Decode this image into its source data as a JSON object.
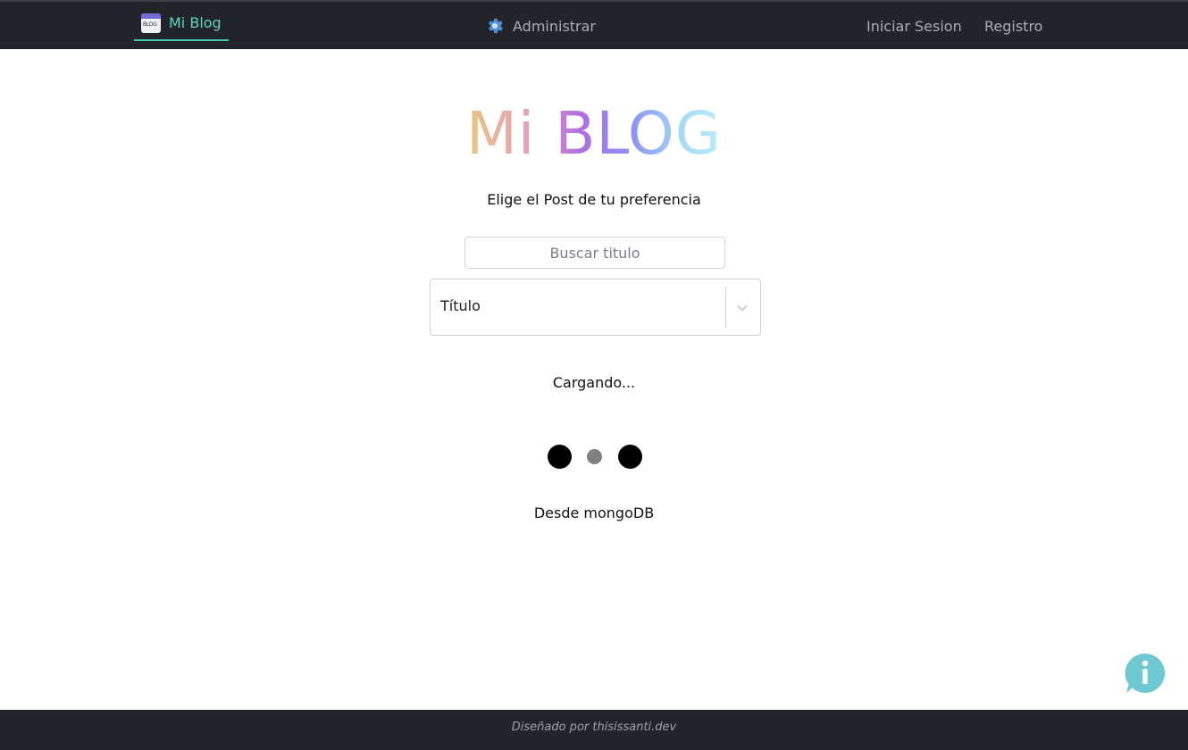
{
  "navbar": {
    "brand_label": "Mi Blog",
    "brand_icon_text": "BLOG",
    "admin_label": "Administrar",
    "login_label": "Iniciar Sesion",
    "register_label": "Registro"
  },
  "main": {
    "title": "Mi BLOG",
    "subtitle": "Elige el Post de tu preferencia",
    "search_placeholder": "Buscar titulo",
    "search_value": "",
    "select_value": "Título",
    "loading_text": "Cargando...",
    "source_text": "Desde mongoDB"
  },
  "footer": {
    "text": "Diseñado por thisissanti.dev"
  },
  "icons": {
    "brand": "blog-logo-icon",
    "admin": "gear-icon",
    "select": "chevron-down-icon",
    "info": "info-icon"
  },
  "colors": {
    "navbar_bg": "#212529",
    "brand_accent": "#5fd3bf",
    "nav_text": "#a9adb1",
    "gear": "#4f8fd8",
    "info_bubble": "#6fc9d2",
    "loader_dark": "#000000",
    "loader_mid": "#808080"
  }
}
